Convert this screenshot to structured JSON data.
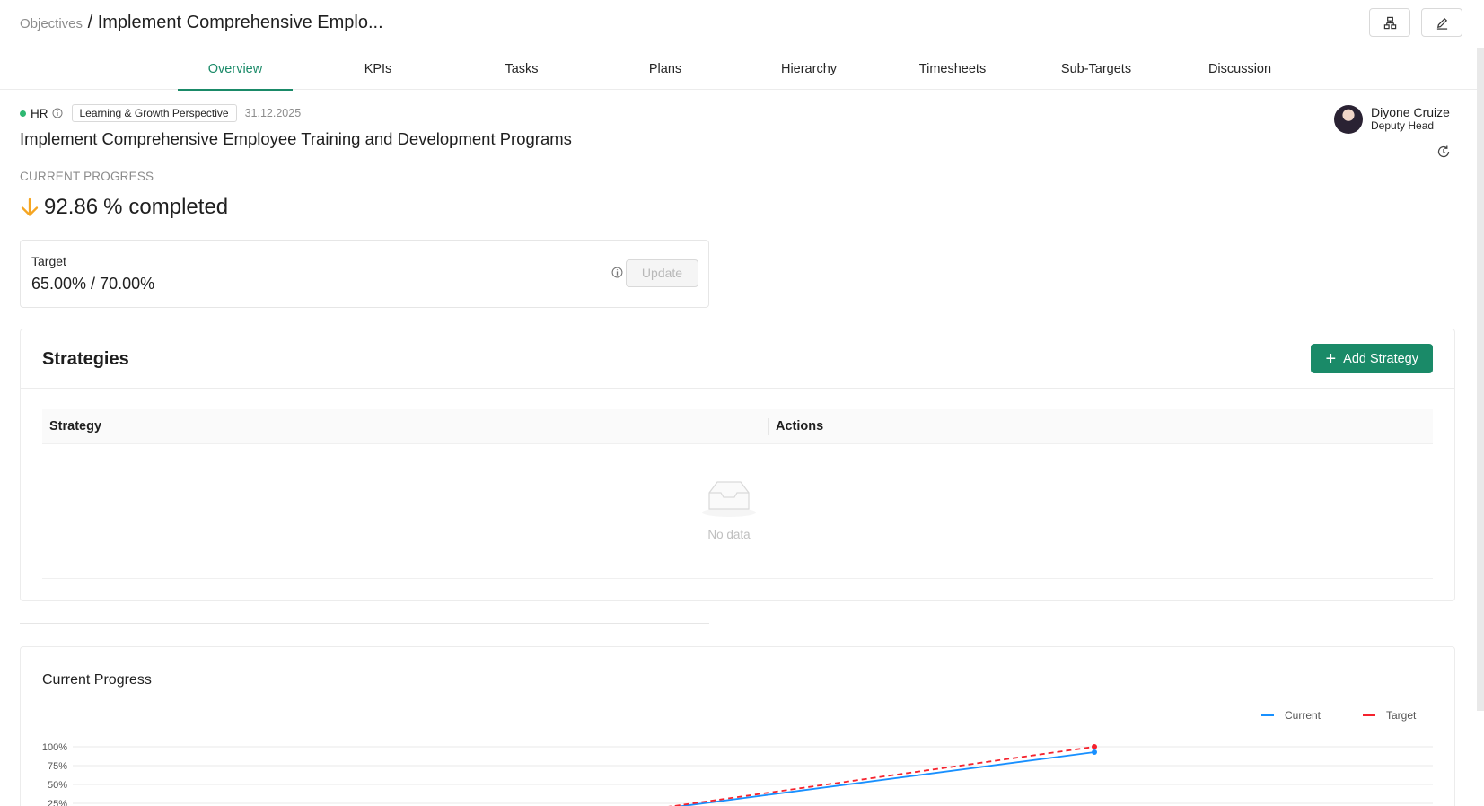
{
  "breadcrumb": {
    "parent": "Objectives",
    "separator": "/",
    "current": "Implement Comprehensive Emplo..."
  },
  "tabs": [
    {
      "label": "Overview",
      "active": true
    },
    {
      "label": "KPIs"
    },
    {
      "label": "Tasks"
    },
    {
      "label": "Plans"
    },
    {
      "label": "Hierarchy"
    },
    {
      "label": "Timesheets"
    },
    {
      "label": "Sub-Targets"
    },
    {
      "label": "Discussion"
    }
  ],
  "objective": {
    "department": "HR",
    "perspective": "Learning & Growth Perspective",
    "date": "31.12.2025",
    "title": "Implement Comprehensive Employee Training and Development Programs"
  },
  "owner": {
    "name": "Diyone Cruize",
    "role": "Deputy Head"
  },
  "progress": {
    "label": "CURRENT PROGRESS",
    "value": "92.86",
    "unit": "%",
    "suffix": "completed",
    "trend": "down"
  },
  "target": {
    "label": "Target",
    "value": "65.00% / 70.00%",
    "update_label": "Update"
  },
  "strategies": {
    "title": "Strategies",
    "add_label": "Add Strategy",
    "columns": [
      "Strategy",
      "Actions"
    ],
    "empty_text": "No data"
  },
  "colors": {
    "accent": "#1a8a68",
    "current": "#1890ff",
    "target": "#f5222d",
    "trend_down": "#f5a623"
  },
  "chart_data": {
    "type": "line",
    "title": "Current Progress",
    "legend_position": "top-right",
    "y_ticks": [
      "100%",
      "75%",
      "50%",
      "25%"
    ],
    "ylim": [
      0,
      100
    ],
    "grid": true,
    "series": [
      {
        "name": "Current",
        "values": [
          0,
          92.86
        ]
      },
      {
        "name": "Target",
        "values": [
          0,
          100
        ]
      }
    ]
  }
}
